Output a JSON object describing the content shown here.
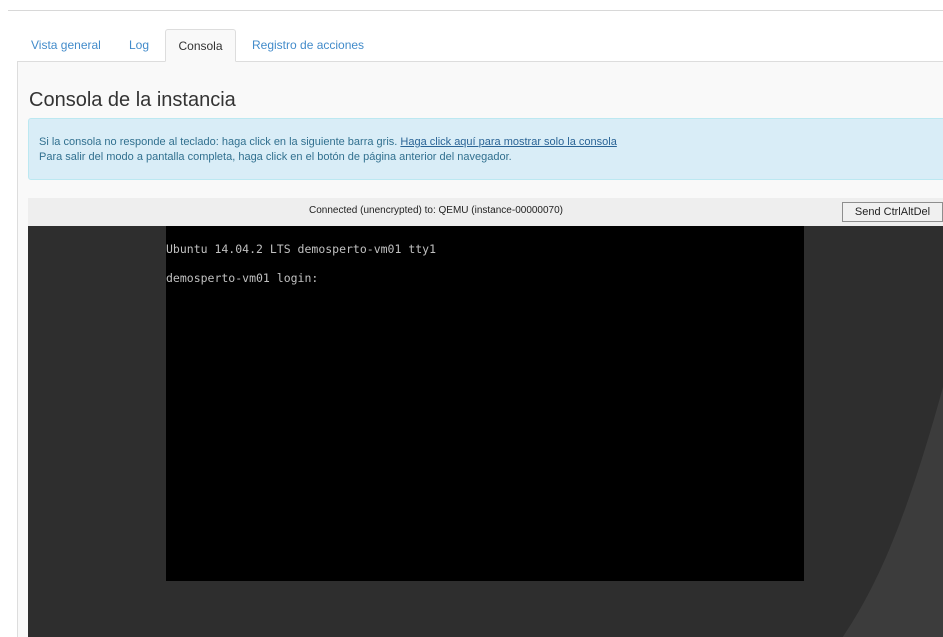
{
  "tabs": [
    {
      "label": "Vista general",
      "active": false
    },
    {
      "label": "Log",
      "active": false
    },
    {
      "label": "Consola",
      "active": true
    },
    {
      "label": "Registro de acciones",
      "active": false
    }
  ],
  "page_title": "Consola de la instancia",
  "info": {
    "line1_text": "Si la consola no responde al teclado: haga click en la siguiente barra gris. ",
    "line1_link": "Haga click aquí para mostrar solo la consola",
    "line2_text": "Para salir del modo a pantalla completa, haga click en el botón de página anterior del navegador."
  },
  "console": {
    "status": "Connected (unencrypted) to: QEMU (instance-00000070)",
    "send_button": "Send CtrlAltDel",
    "screen_lines": [
      "Ubuntu 14.04.2 LTS demosperto-vm01 tty1",
      "demosperto-vm01 login:"
    ]
  },
  "colors": {
    "link": "#428bca",
    "info_bg": "#d9edf7",
    "info_text": "#31708f",
    "console_bg": "#2e2e2e",
    "screen_bg": "#000000"
  }
}
